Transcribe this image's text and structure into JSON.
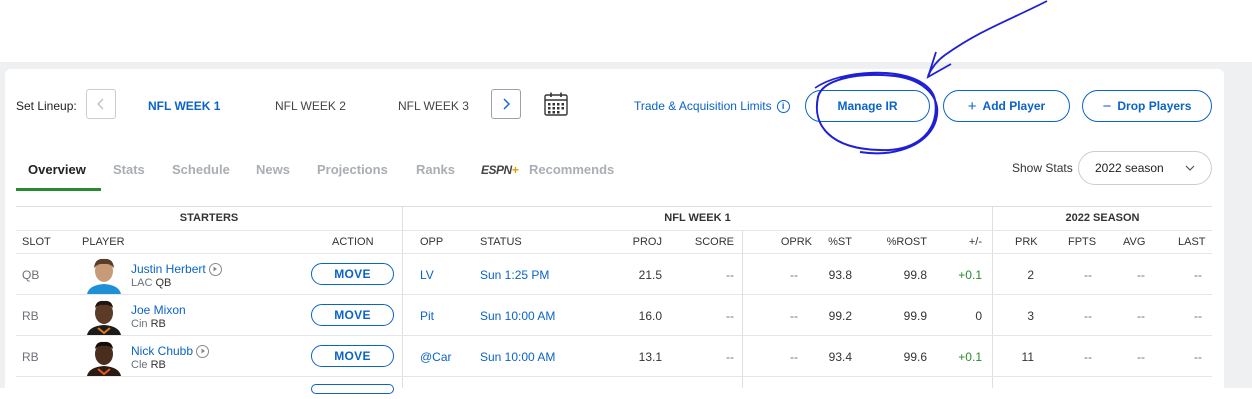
{
  "lineup": {
    "label": "Set Lineup:",
    "weeks": [
      "NFL WEEK 1",
      "NFL WEEK 2",
      "NFL WEEK 3"
    ],
    "active_week": 0,
    "trade_link": "Trade & Acquisition Limits",
    "info_symbol": "i"
  },
  "buttons": {
    "manage_ir": "Manage IR",
    "add_player": "Add Player",
    "drop_players": "Drop Players"
  },
  "tabs": [
    "Overview",
    "Stats",
    "Schedule",
    "News",
    "Projections",
    "Ranks",
    "Recommends"
  ],
  "espn_brand": {
    "text": "ESPN",
    "plus": "+"
  },
  "show_stats": {
    "label": "Show Stats",
    "selected": "2022 season"
  },
  "table": {
    "groups": {
      "starters": "STARTERS",
      "week": "NFL WEEK 1",
      "season": "2022 SEASON"
    },
    "columns": {
      "slot": "SLOT",
      "player": "PLAYER",
      "action": "ACTION",
      "opp": "OPP",
      "status": "STATUS",
      "proj": "PROJ",
      "score": "SCORE",
      "oprk": "OPRK",
      "pst": "%ST",
      "prost": "%ROST",
      "pm": "+/-",
      "prk": "PRK",
      "fpts": "FPTS",
      "avg": "AVG",
      "last": "LAST"
    },
    "rows": [
      {
        "slot": "QB",
        "name": "Justin Herbert",
        "team": "LAC",
        "pos": "QB",
        "action": "MOVE",
        "opp": "LV",
        "status": "Sun 1:25 PM",
        "proj": "21.5",
        "score": "--",
        "oprk": "--",
        "pst": "93.8",
        "prost": "99.8",
        "pm": "+0.1",
        "prk": "2",
        "fpts": "--",
        "avg": "--",
        "last": "--",
        "has_video": true
      },
      {
        "slot": "RB",
        "name": "Joe Mixon",
        "team": "Cin",
        "pos": "RB",
        "action": "MOVE",
        "opp": "Pit",
        "status": "Sun 10:00 AM",
        "proj": "16.0",
        "score": "--",
        "oprk": "--",
        "pst": "99.2",
        "prost": "99.9",
        "pm": "0",
        "prk": "3",
        "fpts": "--",
        "avg": "--",
        "last": "--",
        "has_video": false
      },
      {
        "slot": "RB",
        "name": "Nick Chubb",
        "team": "Cle",
        "pos": "RB",
        "action": "MOVE",
        "opp": "@Car",
        "status": "Sun 10:00 AM",
        "proj": "13.1",
        "score": "--",
        "oprk": "--",
        "pst": "93.4",
        "prost": "99.6",
        "pm": "+0.1",
        "prk": "11",
        "fpts": "--",
        "avg": "--",
        "last": "--",
        "has_video": true
      }
    ]
  },
  "colors": {
    "accent": "#0b63c9",
    "active_tab_underline": "#2a8a2e",
    "positive": "#2a8a2e",
    "annotation": "#1f1fd6"
  }
}
